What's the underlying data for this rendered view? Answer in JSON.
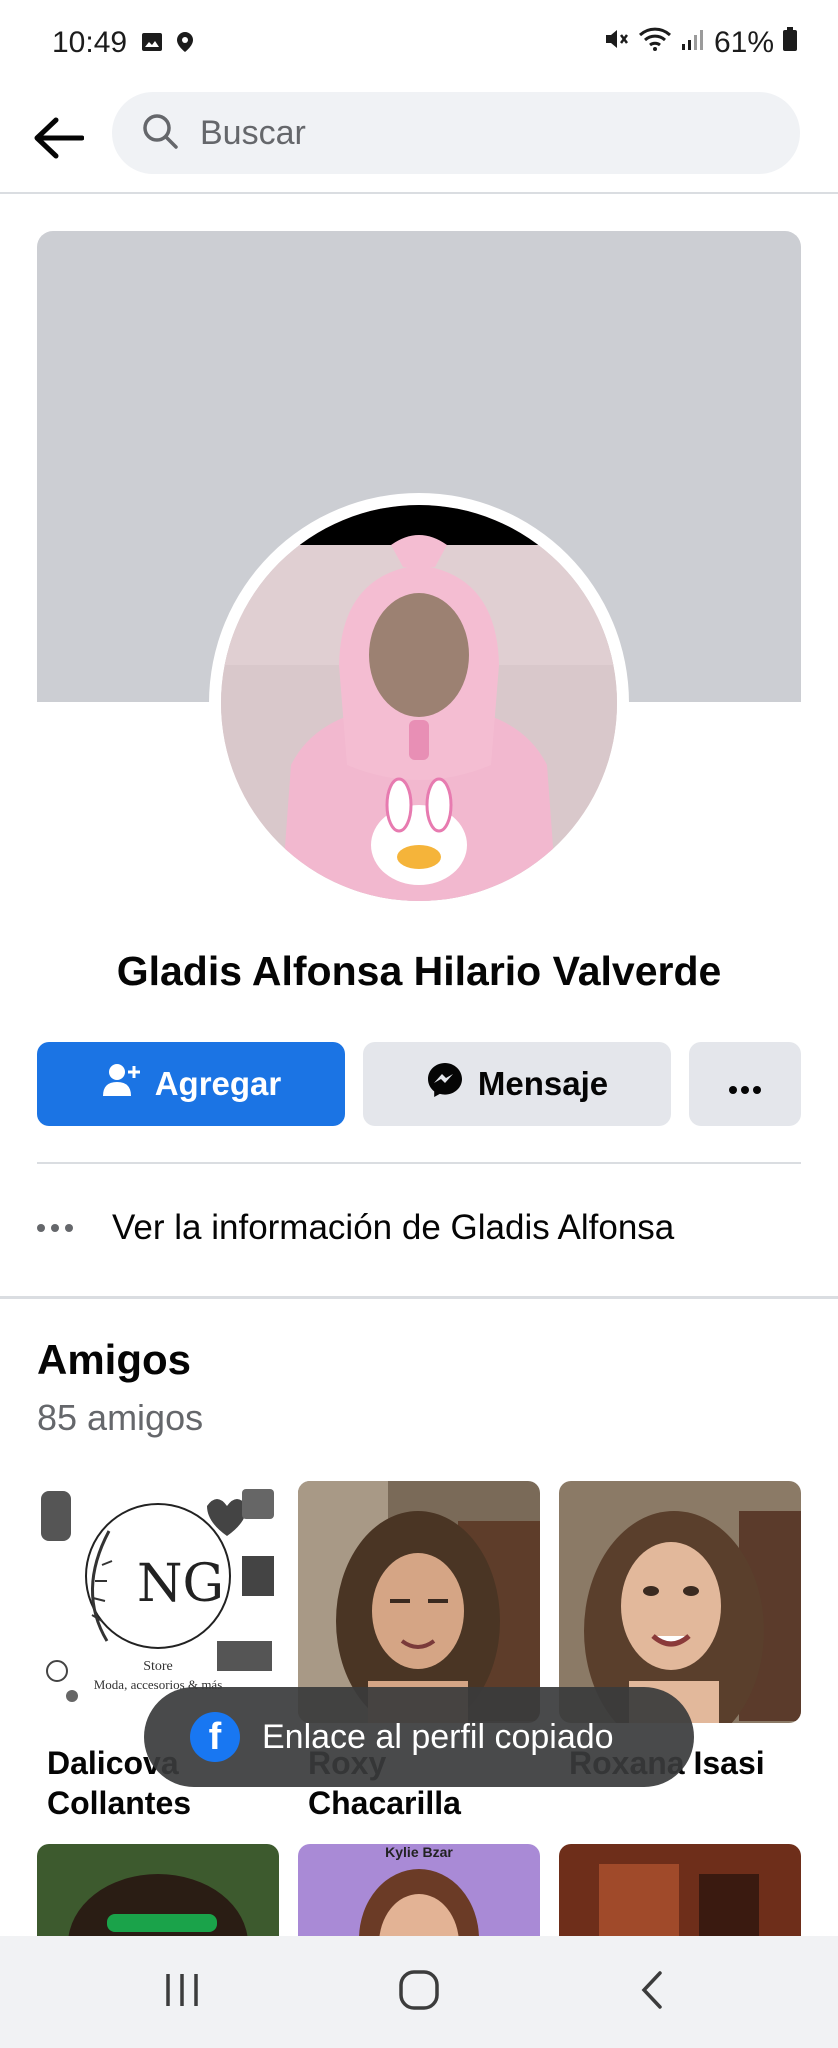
{
  "status_bar": {
    "time": "10:49",
    "battery": "61%"
  },
  "search": {
    "placeholder": "Buscar"
  },
  "profile": {
    "name": "Gladis Alfonsa Hilario Valverde"
  },
  "actions": {
    "add_label": "Agregar",
    "message_label": "Mensaje",
    "more_label": "..."
  },
  "info": {
    "label": "Ver la información de Gladis Alfonsa"
  },
  "friends": {
    "title": "Amigos",
    "count": "85 amigos",
    "store_caption": "Store",
    "store_sub": "Moda, accesorios & más",
    "items": [
      {
        "name": "Dalicova Collantes"
      },
      {
        "name": "Roxy Chacarilla"
      },
      {
        "name": "Roxana Isasi"
      }
    ],
    "row2_caption": "Kylie Bzar"
  },
  "toast": {
    "text": "Enlace al perfil copiado"
  },
  "colors": {
    "primary": "#1b74e4",
    "cover": "#ccced3",
    "secondary_button": "#e4e6eb",
    "muted_text": "#65676b"
  },
  "icons": [
    "image-icon",
    "location-icon",
    "mute-icon",
    "wifi-icon",
    "signal-icon",
    "battery-icon",
    "back-arrow-icon",
    "search-icon",
    "add-friend-icon",
    "messenger-icon",
    "more-icon",
    "facebook-icon",
    "recents-icon",
    "home-icon",
    "back-icon"
  ]
}
